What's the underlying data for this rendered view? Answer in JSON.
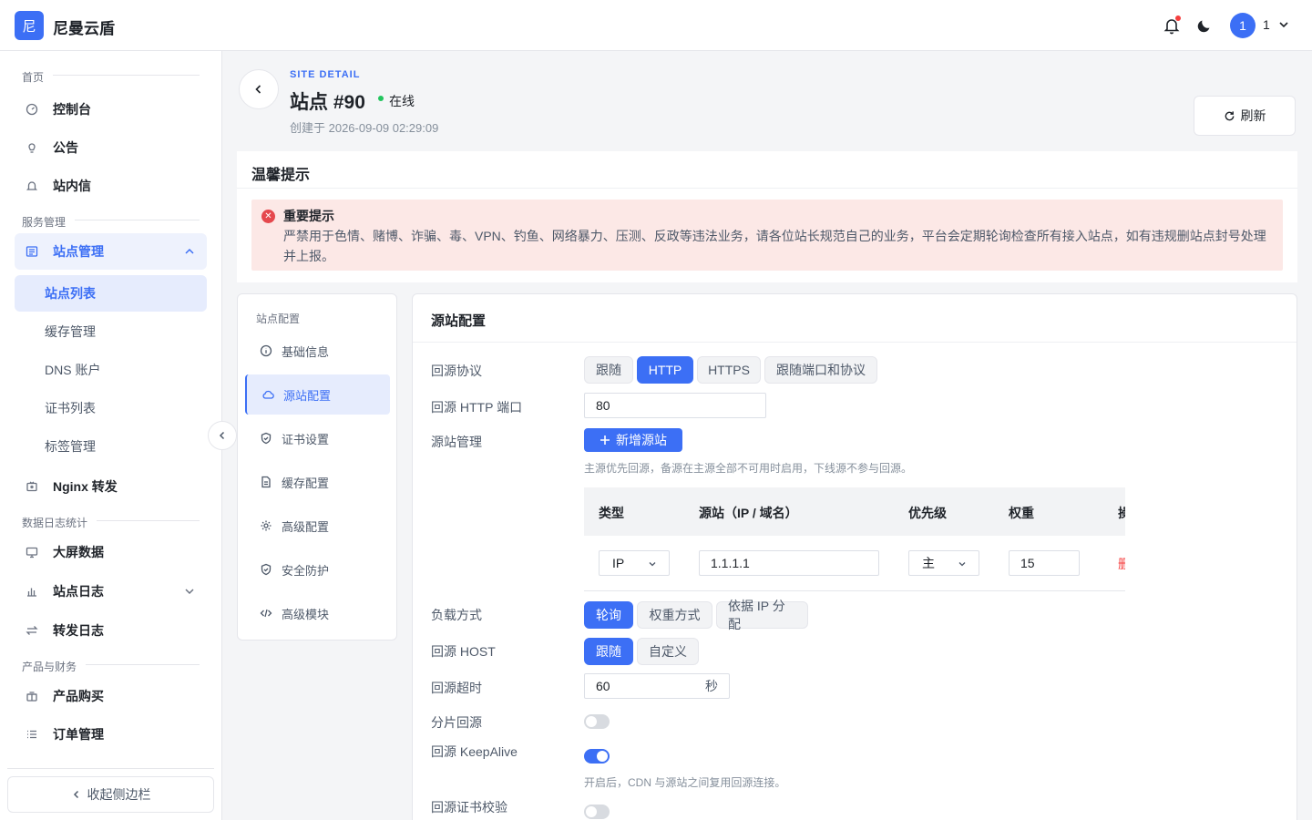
{
  "header": {
    "logo_char": "尼",
    "brand": "尼曼云盾",
    "user_avatar": "1",
    "user_name": "1"
  },
  "sidebar": {
    "section_home": "首页",
    "items_home": [
      "控制台",
      "公告",
      "站内信"
    ],
    "section_service": "服务管理",
    "site_manage": "站点管理",
    "site_sub": [
      "站点列表",
      "缓存管理",
      "DNS 账户",
      "证书列表",
      "标签管理"
    ],
    "nginx": "Nginx 转发",
    "section_stats": "数据日志统计",
    "items_stats": [
      "大屏数据",
      "站点日志",
      "转发日志"
    ],
    "section_finance": "产品与财务",
    "items_finance": [
      "产品购买",
      "订单管理"
    ],
    "collapse_label": "收起侧边栏"
  },
  "page": {
    "eyebrow": "SITE DETAIL",
    "title": "站点 #90",
    "status": "在线",
    "created": "创建于 2026-09-09 02:29:09",
    "refresh": "刷新"
  },
  "notice": {
    "title": "温馨提示",
    "alert_title": "重要提示",
    "alert_body": "严禁用于色情、赌博、诈骗、毒、VPN、钓鱼、网络暴力、压测、反政等违法业务，请各位站长规范自己的业务，平台会定期轮询检查所有接入站点，如有违规删站点封号处理并上报。"
  },
  "config_menu": {
    "title": "站点配置",
    "items": [
      "基础信息",
      "源站配置",
      "证书设置",
      "缓存配置",
      "高级配置",
      "安全防护",
      "高级模块"
    ]
  },
  "origin": {
    "title": "源站配置",
    "protocol_label": "回源协议",
    "protocol_options": [
      "跟随",
      "HTTP",
      "HTTPS",
      "跟随端口和协议"
    ],
    "protocol_selected": "HTTP",
    "port_label": "回源 HTTP 端口",
    "port_value": "80",
    "source_label": "源站管理",
    "add_source": "新增源站",
    "source_hint": "主源优先回源，备源在主源全部不可用时启用，下线源不参与回源。",
    "table_headers": [
      "类型",
      "源站（IP / 域名）",
      "优先级",
      "权重",
      "操"
    ],
    "row": {
      "type": "IP",
      "address": "1.1.1.1",
      "priority": "主",
      "weight": "15",
      "action": "删"
    },
    "lb_label": "负载方式",
    "lb_options": [
      "轮询",
      "权重方式",
      "依据 IP 分配"
    ],
    "lb_selected": "轮询",
    "host_label": "回源 HOST",
    "host_options": [
      "跟随",
      "自定义"
    ],
    "host_selected": "跟随",
    "timeout_label": "回源超时",
    "timeout_value": "60",
    "timeout_unit": "秒",
    "range_label": "分片回源",
    "range_on": false,
    "keepalive_label": "回源 KeepAlive",
    "keepalive_on": true,
    "keepalive_hint": "开启后，CDN 与源站之间复用回源连接。",
    "verify_label": "回源证书校验",
    "verify_on": false
  },
  "colors": {
    "accent": "#3c6ff5",
    "danger": "#e5484d",
    "online": "#22c55e"
  }
}
